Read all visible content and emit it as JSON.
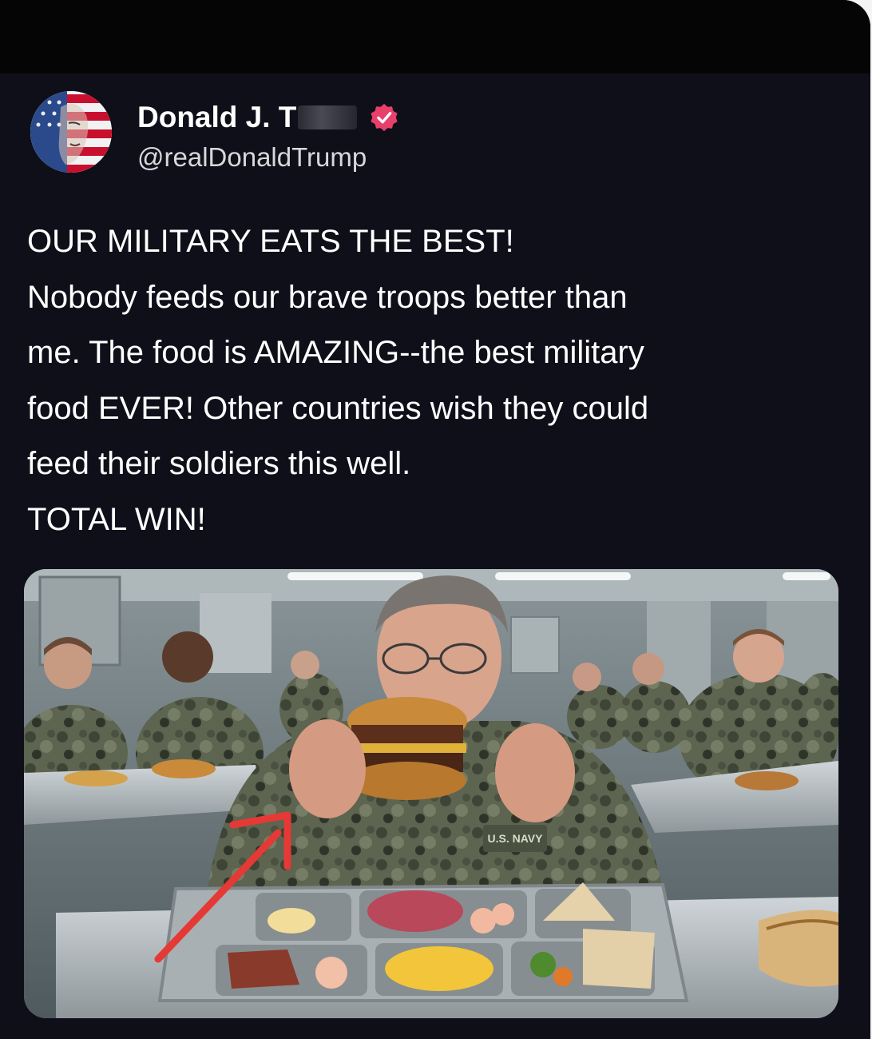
{
  "post": {
    "author_name": "Donald J. T",
    "author_handle": "@realDonaldTrump",
    "verified": true,
    "text_lines": [
      "OUR MILITARY EATS THE BEST!",
      "Nobody feeds our brave troops better than",
      "me. The food is AMAZING--the best military",
      "food EVER! Other countries wish they could",
      "feed their soldiers this well.",
      "TOTAL WIN!"
    ],
    "image": {
      "patch_label": "U.S. NAVY"
    }
  },
  "colors": {
    "background": "#0f0f1a",
    "verified_badge": "#e8406b",
    "arrow": "#e53935"
  }
}
